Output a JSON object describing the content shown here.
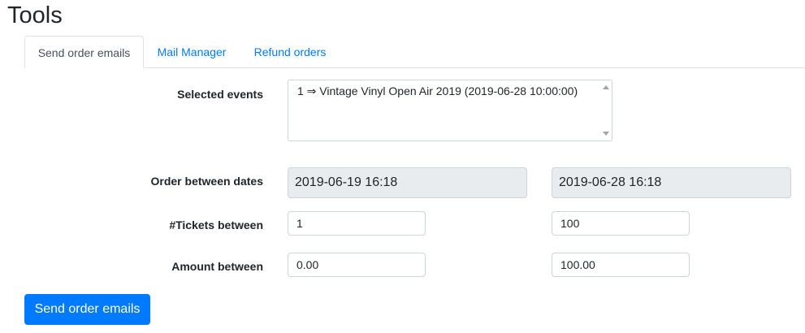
{
  "page": {
    "title": "Tools"
  },
  "tabs": [
    {
      "label": "Send order emails",
      "active": true
    },
    {
      "label": "Mail Manager",
      "active": false
    },
    {
      "label": "Refund orders",
      "active": false
    }
  ],
  "form": {
    "selected_events": {
      "label": "Selected events",
      "options": [
        "1 ⇒ Vintage Vinyl Open Air 2019 (2019-06-28 10:00:00)"
      ]
    },
    "order_dates": {
      "label": "Order between dates",
      "from": "2019-06-19 16:18",
      "to": "2019-06-28 16:18"
    },
    "tickets": {
      "label": "#Tickets between",
      "min": "1",
      "max": "100"
    },
    "amount": {
      "label": "Amount between",
      "min": "0.00",
      "max": "100.00"
    },
    "submit_label": "Send order emails"
  },
  "colors": {
    "primary": "#007bff",
    "readonly_bg": "#e9ecef",
    "border": "#ced4da",
    "tab_border": "#dee2e6"
  },
  "icons": {
    "scroll_up": "triangle-up-icon",
    "scroll_down": "triangle-down-icon"
  }
}
